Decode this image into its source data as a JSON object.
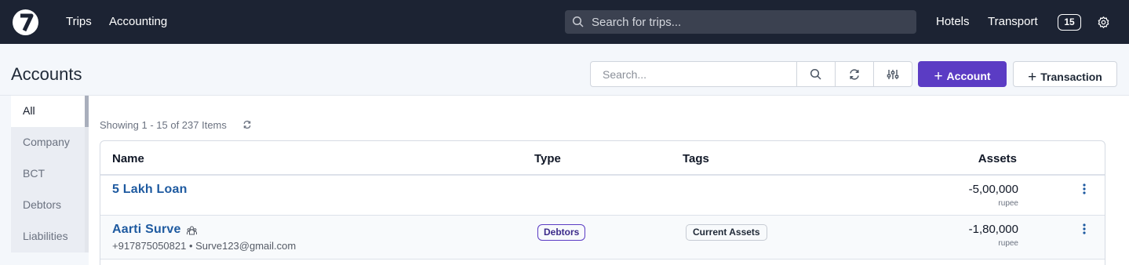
{
  "topbar": {
    "nav": [
      "Trips",
      "Accounting"
    ],
    "search_placeholder": "Search for trips...",
    "right_links": [
      "Hotels",
      "Transport"
    ],
    "notification_count": "15"
  },
  "page": {
    "title": "Accounts",
    "search_placeholder": "Search...",
    "add_account_label": "Account",
    "add_transaction_label": "Transaction",
    "accent_color": "#5b3cc4"
  },
  "sidebar": {
    "items": [
      "All",
      "Company",
      "BCT",
      "Debtors",
      "Liabilities"
    ],
    "active": "All"
  },
  "listing": {
    "showing": "Showing 1 - 15 of 237 Items"
  },
  "table": {
    "columns": [
      "Name",
      "Type",
      "Tags",
      "Assets"
    ],
    "rows": [
      {
        "name": "5 Lakh Loan",
        "contact": "",
        "type": "",
        "tag": "",
        "amount": "-5,00,000",
        "unit": "rupee"
      },
      {
        "name": "Aarti Surve",
        "contact": "+917875050821 • Surve123@gmail.com",
        "type": "Debtors",
        "tag": "Current Assets",
        "amount": "-1,80,000",
        "unit": "rupee"
      }
    ]
  }
}
